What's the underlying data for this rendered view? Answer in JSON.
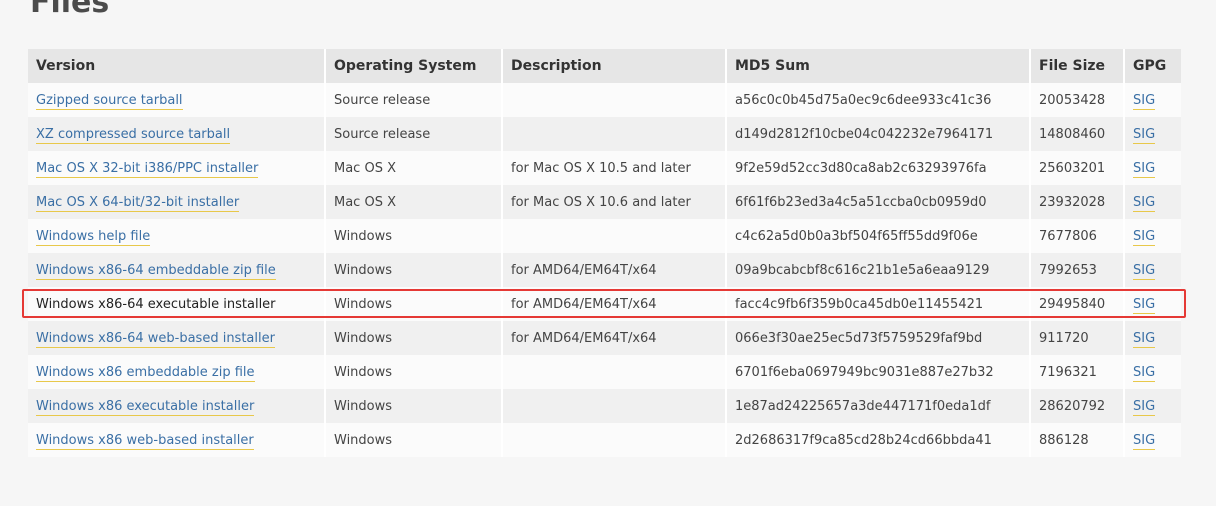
{
  "page": {
    "heading": "Files"
  },
  "table": {
    "headers": {
      "version": "Version",
      "os": "Operating System",
      "description": "Description",
      "md5": "MD5 Sum",
      "size": "File Size",
      "gpg": "GPG"
    },
    "rows": [
      {
        "version": "Gzipped source tarball",
        "os": "Source release",
        "description": "",
        "md5": "a56c0c0b45d75a0ec9c6dee933c41c36",
        "size": "20053428",
        "gpg": "SIG"
      },
      {
        "version": "XZ compressed source tarball",
        "os": "Source release",
        "description": "",
        "md5": "d149d2812f10cbe04c042232e7964171",
        "size": "14808460",
        "gpg": "SIG"
      },
      {
        "version": "Mac OS X 32-bit i386/PPC installer",
        "os": "Mac OS X",
        "description": "for Mac OS X 10.5 and later",
        "md5": "9f2e59d52cc3d80ca8ab2c63293976fa",
        "size": "25603201",
        "gpg": "SIG"
      },
      {
        "version": "Mac OS X 64-bit/32-bit installer",
        "os": "Mac OS X",
        "description": "for Mac OS X 10.6 and later",
        "md5": "6f61f6b23ed3a4c5a51ccba0cb0959d0",
        "size": "23932028",
        "gpg": "SIG"
      },
      {
        "version": "Windows help file",
        "os": "Windows",
        "description": "",
        "md5": "c4c62a5d0b0a3bf504f65ff55dd9f06e",
        "size": "7677806",
        "gpg": "SIG"
      },
      {
        "version": "Windows x86-64 embeddable zip file",
        "os": "Windows",
        "description": "for AMD64/EM64T/x64",
        "md5": "09a9bcabcbf8c616c21b1e5a6eaa9129",
        "size": "7992653",
        "gpg": "SIG"
      },
      {
        "version": "Windows x86-64 executable installer",
        "os": "Windows",
        "description": "for AMD64/EM64T/x64",
        "md5": "facc4c9fb6f359b0ca45db0e11455421",
        "size": "29495840",
        "gpg": "SIG"
      },
      {
        "version": "Windows x86-64 web-based installer",
        "os": "Windows",
        "description": "for AMD64/EM64T/x64",
        "md5": "066e3f30ae25ec5d73f5759529faf9bd",
        "size": "911720",
        "gpg": "SIG"
      },
      {
        "version": "Windows x86 embeddable zip file",
        "os": "Windows",
        "description": "",
        "md5": "6701f6eba0697949bc9031e887e27b32",
        "size": "7196321",
        "gpg": "SIG"
      },
      {
        "version": "Windows x86 executable installer",
        "os": "Windows",
        "description": "",
        "md5": "1e87ad24225657a3de447171f0eda1df",
        "size": "28620792",
        "gpg": "SIG"
      },
      {
        "version": "Windows x86 web-based installer",
        "os": "Windows",
        "description": "",
        "md5": "2d2686317f9ca85cd28b24cd66bbda41",
        "size": "886128",
        "gpg": "SIG"
      }
    ]
  },
  "colors": {
    "link": "#3a6fa5",
    "link_underline": "#e8c84a",
    "highlight": "#e53935"
  }
}
